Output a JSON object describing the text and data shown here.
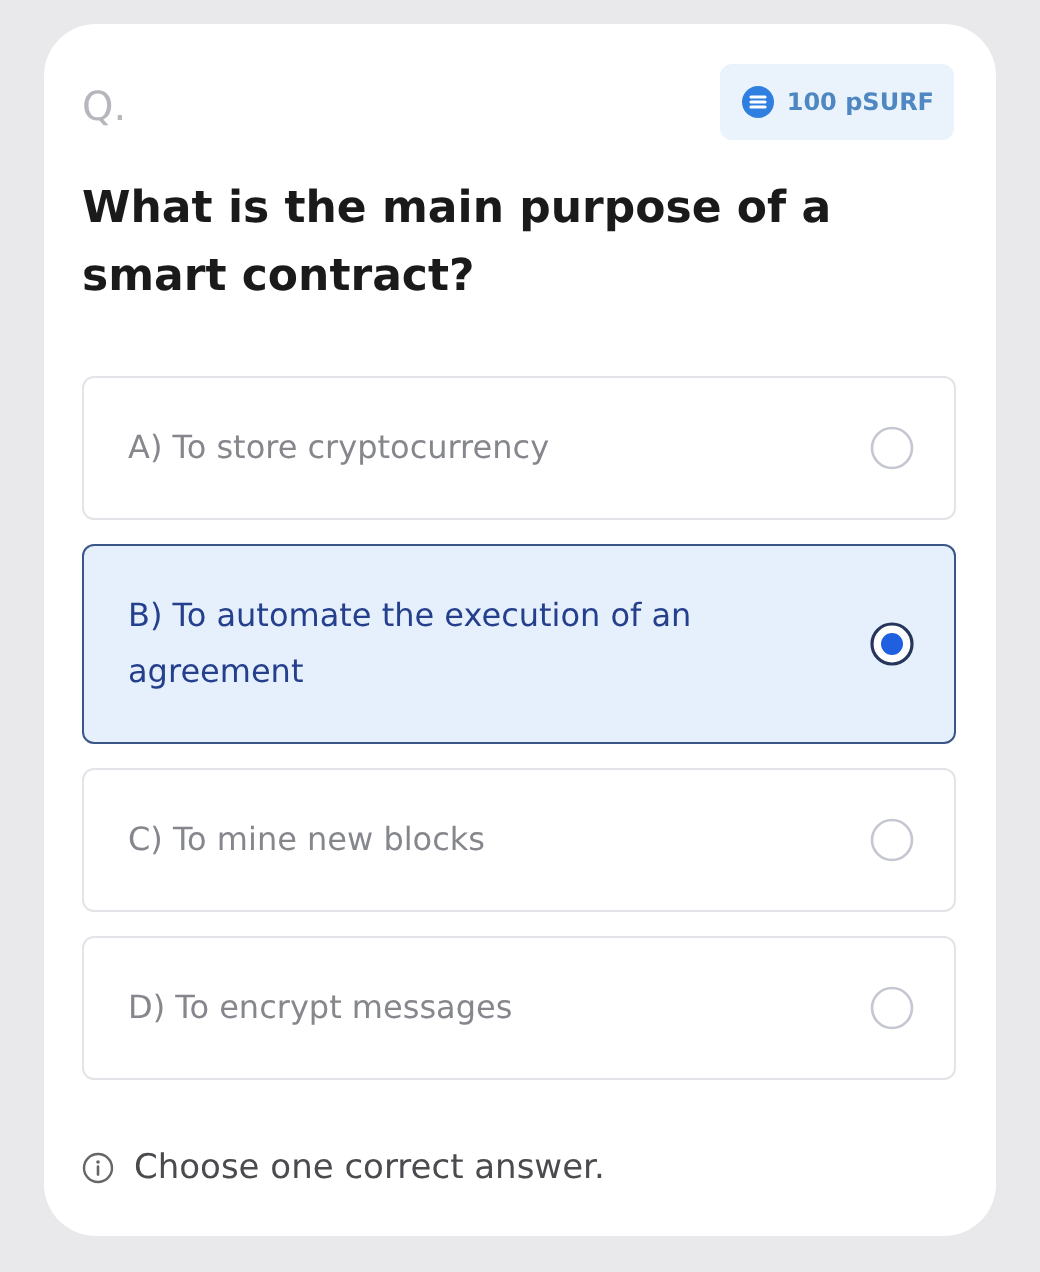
{
  "question_label": "Q.",
  "reward": {
    "amount": "100 pSURF"
  },
  "question": "What is the main purpose of a smart contract?",
  "options": [
    {
      "label": "A) To store cryptocurrency",
      "selected": false
    },
    {
      "label": "B) To automate the execution of an agreement",
      "selected": true
    },
    {
      "label": "C) To mine new blocks",
      "selected": false
    },
    {
      "label": "D) To encrypt messages",
      "selected": false
    }
  ],
  "hint": "Choose one correct answer."
}
